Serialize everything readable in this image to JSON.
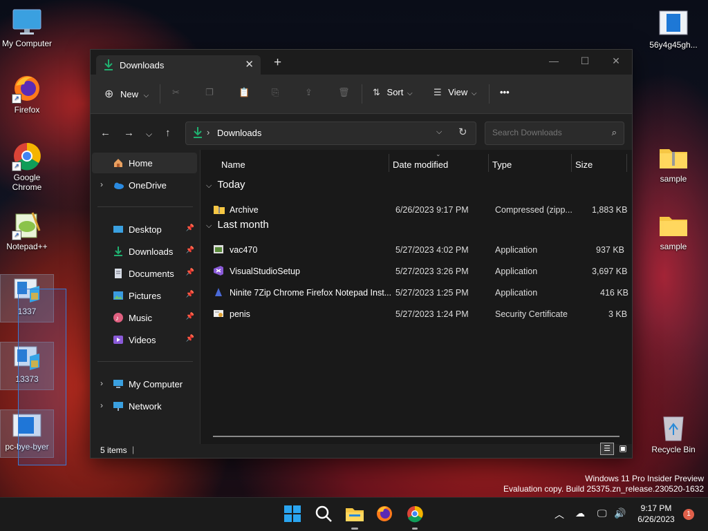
{
  "desktop": {
    "icons": [
      {
        "label": "My Computer"
      },
      {
        "label": "Firefox"
      },
      {
        "label": "Google Chrome"
      },
      {
        "label": "Notepad++"
      },
      {
        "label": "1337"
      },
      {
        "label": "13373"
      },
      {
        "label": "pc-bye-byer"
      },
      {
        "label": "56y4g45gh..."
      },
      {
        "label": "sample"
      },
      {
        "label": "sample"
      },
      {
        "label": "Recycle Bin"
      }
    ],
    "watermark": {
      "line1": "Windows 11 Pro Insider Preview",
      "line2": "Evaluation copy. Build 25375.zn_release.230520-1632"
    }
  },
  "explorer": {
    "tab_title": "Downloads",
    "toolbar": {
      "new_label": "New",
      "sort_label": "Sort",
      "view_label": "View"
    },
    "address": {
      "path": "Downloads"
    },
    "search": {
      "placeholder": "Search Downloads"
    },
    "nav": {
      "home": "Home",
      "onedrive": "OneDrive",
      "quick": [
        {
          "label": "Desktop"
        },
        {
          "label": "Downloads"
        },
        {
          "label": "Documents"
        },
        {
          "label": "Pictures"
        },
        {
          "label": "Music"
        },
        {
          "label": "Videos"
        }
      ],
      "mycomputer": "My Computer",
      "network": "Network"
    },
    "columns": {
      "name": "Name",
      "date": "Date modified",
      "type": "Type",
      "size": "Size"
    },
    "groups": [
      {
        "label": "Today",
        "items": [
          {
            "name": "Archive",
            "date": "6/26/2023 9:17 PM",
            "type": "Compressed (zipp...",
            "size": "1,883 KB"
          }
        ]
      },
      {
        "label": "Last month",
        "items": [
          {
            "name": "vac470",
            "date": "5/27/2023 4:02 PM",
            "type": "Application",
            "size": "937 KB"
          },
          {
            "name": "VisualStudioSetup",
            "date": "5/27/2023 3:26 PM",
            "type": "Application",
            "size": "3,697 KB"
          },
          {
            "name": "Ninite 7Zip Chrome Firefox Notepad Inst...",
            "date": "5/27/2023 1:25 PM",
            "type": "Application",
            "size": "416 KB"
          },
          {
            "name": "penis",
            "date": "5/27/2023 1:24 PM",
            "type": "Security Certificate",
            "size": "3 KB"
          }
        ]
      }
    ],
    "status": {
      "count": "5 items"
    }
  },
  "taskbar": {
    "time": "9:17 PM",
    "date": "6/26/2023",
    "notif_count": "1"
  },
  "colors": {
    "accent": "#0078d4",
    "download_green": "#20b070",
    "folder": "#f6c744"
  }
}
